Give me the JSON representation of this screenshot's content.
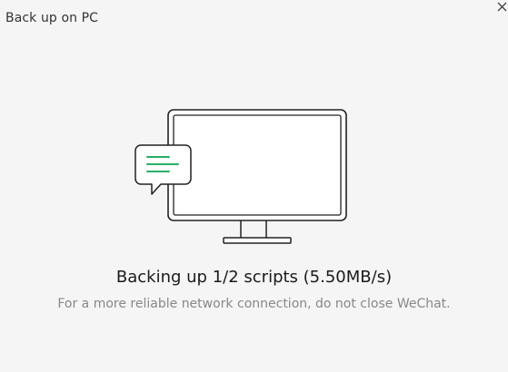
{
  "window": {
    "title": "Back up on PC",
    "close_icon": "close-icon"
  },
  "illustration": {
    "monitor_icon": "monitor-icon",
    "chat_bubble_icon": "chat-bubble-icon",
    "accent_color": "#2aae67"
  },
  "status": {
    "main_text": "Backing up 1/2 scripts (5.50MB/s)",
    "sub_text": "For a more reliable network connection, do not close WeChat."
  }
}
